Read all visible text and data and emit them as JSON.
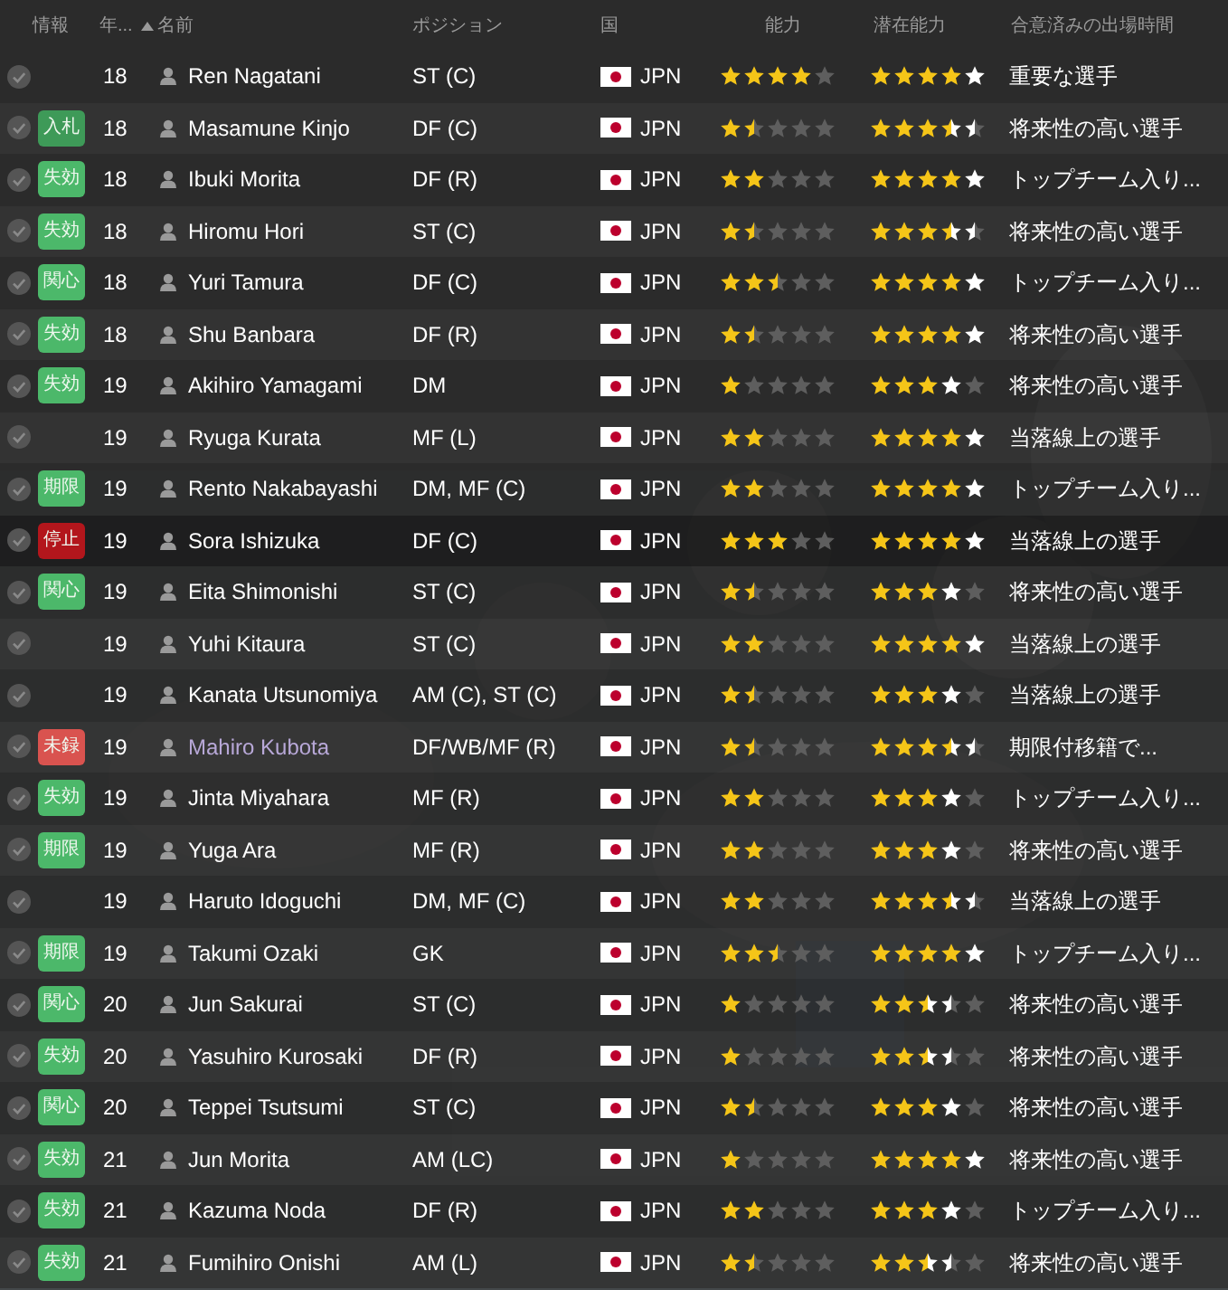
{
  "header": {
    "columns": [
      "情報",
      "年...",
      "名前",
      "ポジション",
      "国",
      "能力",
      "潜在能力",
      "合意済みの出場時間"
    ]
  },
  "rows": [
    {
      "selected": false,
      "age": "18",
      "name": "Ren Nagatani",
      "color": "#ffffff",
      "position": "ST (C)",
      "nation": "JPN",
      "ability": {
        "stars": 4
      },
      "potential": {
        "stars": 4,
        "uncertain": true
      },
      "playing_time": "重要な選手"
    },
    {
      "selected": false,
      "badge": {
        "text": "入札",
        "color": "#3e9a58"
      },
      "age": "18",
      "name": "Masamune Kinjo",
      "color": "#ffffff",
      "position": "DF (C)",
      "nation": "JPN",
      "ability": {
        "stars": 1.5
      },
      "potential": {
        "stars": 3.5,
        "uncertain": true
      },
      "playing_time": "将来性の高い選手"
    },
    {
      "selected": false,
      "badge": {
        "text": "失効",
        "color": "#4cb86a"
      },
      "age": "18",
      "name": "Ibuki Morita",
      "color": "#ffffff",
      "position": "DF (R)",
      "nation": "JPN",
      "ability": {
        "stars": 2
      },
      "potential": {
        "stars": 4,
        "uncertain": true
      },
      "playing_time": "トップチーム入り..."
    },
    {
      "selected": false,
      "badge": {
        "text": "失効",
        "color": "#4cb86a"
      },
      "age": "18",
      "name": "Hiromu Hori",
      "color": "#ffffff",
      "position": "ST (C)",
      "nation": "JPN",
      "ability": {
        "stars": 1.5
      },
      "potential": {
        "stars": 3.5,
        "uncertain": true
      },
      "playing_time": "将来性の高い選手"
    },
    {
      "selected": false,
      "badge": {
        "text": "関心",
        "color": "#4cb86a"
      },
      "age": "18",
      "name": "Yuri Tamura",
      "color": "#ffffff",
      "position": "DF (C)",
      "nation": "JPN",
      "ability": {
        "stars": 2.5
      },
      "potential": {
        "stars": 4,
        "uncertain": true
      },
      "playing_time": "トップチーム入り..."
    },
    {
      "selected": false,
      "badge": {
        "text": "失効",
        "color": "#4cb86a"
      },
      "age": "18",
      "name": "Shu Banbara",
      "color": "#ffffff",
      "position": "DF (R)",
      "nation": "JPN",
      "ability": {
        "stars": 1.5
      },
      "potential": {
        "stars": 4,
        "uncertain": true
      },
      "playing_time": "将来性の高い選手"
    },
    {
      "selected": false,
      "badge": {
        "text": "失効",
        "color": "#4cb86a"
      },
      "age": "19",
      "name": "Akihiro Yamagami",
      "color": "#ffffff",
      "position": "DM",
      "nation": "JPN",
      "ability": {
        "stars": 1
      },
      "potential": {
        "stars": 3,
        "uncertain": true
      },
      "playing_time": "将来性の高い選手"
    },
    {
      "selected": false,
      "age": "19",
      "name": "Ryuga Kurata",
      "color": "#ffffff",
      "position": "MF (L)",
      "nation": "JPN",
      "ability": {
        "stars": 2
      },
      "potential": {
        "stars": 4,
        "uncertain": true
      },
      "playing_time": "当落線上の選手"
    },
    {
      "selected": false,
      "badge": {
        "text": "期限",
        "color": "#4cb86a"
      },
      "age": "19",
      "name": "Rento Nakabayashi",
      "color": "#ffffff",
      "position": "DM, MF (C)",
      "nation": "JPN",
      "ability": {
        "stars": 2
      },
      "potential": {
        "stars": 4,
        "uncertain": true
      },
      "playing_time": "トップチーム入り..."
    },
    {
      "selected": true,
      "badge": {
        "text": "停止",
        "color": "#b3161c"
      },
      "age": "19",
      "name": "Sora Ishizuka",
      "color": "#ffffff",
      "position": "DF (C)",
      "nation": "JPN",
      "ability": {
        "stars": 3
      },
      "potential": {
        "stars": 4,
        "uncertain": true
      },
      "playing_time": "当落線上の選手"
    },
    {
      "selected": false,
      "badge": {
        "text": "関心",
        "color": "#4cb86a"
      },
      "age": "19",
      "name": "Eita Shimonishi",
      "color": "#ffffff",
      "position": "ST (C)",
      "nation": "JPN",
      "ability": {
        "stars": 1.5
      },
      "potential": {
        "stars": 3,
        "uncertain": true
      },
      "playing_time": "将来性の高い選手"
    },
    {
      "selected": false,
      "age": "19",
      "name": "Yuhi Kitaura",
      "color": "#ffffff",
      "position": "ST (C)",
      "nation": "JPN",
      "ability": {
        "stars": 2
      },
      "potential": {
        "stars": 4,
        "uncertain": true
      },
      "playing_time": "当落線上の選手"
    },
    {
      "selected": false,
      "age": "19",
      "name": "Kanata Utsunomiya",
      "color": "#ffffff",
      "position": "AM (C), ST (C)",
      "nation": "JPN",
      "ability": {
        "stars": 1.5
      },
      "potential": {
        "stars": 3,
        "uncertain": true
      },
      "playing_time": "当落線上の選手"
    },
    {
      "selected": false,
      "badge": {
        "text": "未録",
        "color": "#d9534f"
      },
      "age": "19",
      "name": "Mahiro Kubota",
      "color": "#b8a8d8",
      "position": "DF/WB/MF (R)",
      "nation": "JPN",
      "ability": {
        "stars": 1.5
      },
      "potential": {
        "stars": 3.5,
        "uncertain": true
      },
      "playing_time": "期限付移籍で..."
    },
    {
      "selected": false,
      "badge": {
        "text": "失効",
        "color": "#4cb86a"
      },
      "age": "19",
      "name": "Jinta Miyahara",
      "color": "#ffffff",
      "position": "MF (R)",
      "nation": "JPN",
      "ability": {
        "stars": 2
      },
      "potential": {
        "stars": 3,
        "uncertain": true
      },
      "playing_time": "トップチーム入り..."
    },
    {
      "selected": false,
      "badge": {
        "text": "期限",
        "color": "#4cb86a"
      },
      "age": "19",
      "name": "Yuga Ara",
      "color": "#ffffff",
      "position": "MF (R)",
      "nation": "JPN",
      "ability": {
        "stars": 2
      },
      "potential": {
        "stars": 3,
        "uncertain": true
      },
      "playing_time": "将来性の高い選手"
    },
    {
      "selected": false,
      "age": "19",
      "name": "Haruto Idoguchi",
      "color": "#ffffff",
      "position": "DM, MF (C)",
      "nation": "JPN",
      "ability": {
        "stars": 2
      },
      "potential": {
        "stars": 3.5,
        "uncertain": true
      },
      "playing_time": "当落線上の選手"
    },
    {
      "selected": false,
      "badge": {
        "text": "期限",
        "color": "#4cb86a"
      },
      "age": "19",
      "name": "Takumi Ozaki",
      "color": "#ffffff",
      "position": "GK",
      "nation": "JPN",
      "ability": {
        "stars": 2.5
      },
      "potential": {
        "stars": 4,
        "uncertain": true
      },
      "playing_time": "トップチーム入り..."
    },
    {
      "selected": false,
      "badge": {
        "text": "関心",
        "color": "#4cb86a"
      },
      "age": "20",
      "name": "Jun Sakurai",
      "color": "#ffffff",
      "position": "ST (C)",
      "nation": "JPN",
      "ability": {
        "stars": 1
      },
      "potential": {
        "stars": 2.5,
        "uncertain": true
      },
      "playing_time": "将来性の高い選手"
    },
    {
      "selected": false,
      "badge": {
        "text": "失効",
        "color": "#4cb86a"
      },
      "age": "20",
      "name": "Yasuhiro Kurosaki",
      "color": "#ffffff",
      "position": "DF (R)",
      "nation": "JPN",
      "ability": {
        "stars": 1
      },
      "potential": {
        "stars": 2.5,
        "uncertain": true
      },
      "playing_time": "将来性の高い選手"
    },
    {
      "selected": false,
      "badge": {
        "text": "関心",
        "color": "#4cb86a"
      },
      "age": "20",
      "name": "Teppei Tsutsumi",
      "color": "#ffffff",
      "position": "ST (C)",
      "nation": "JPN",
      "ability": {
        "stars": 1.5
      },
      "potential": {
        "stars": 3,
        "uncertain": true
      },
      "playing_time": "将来性の高い選手"
    },
    {
      "selected": false,
      "badge": {
        "text": "失効",
        "color": "#4cb86a"
      },
      "age": "21",
      "name": "Jun Morita",
      "color": "#ffffff",
      "position": "AM (LC)",
      "nation": "JPN",
      "ability": {
        "stars": 1
      },
      "potential": {
        "stars": 4,
        "uncertain": true
      },
      "playing_time": "将来性の高い選手"
    },
    {
      "selected": false,
      "badge": {
        "text": "失効",
        "color": "#4cb86a"
      },
      "age": "21",
      "name": "Kazuma Noda",
      "color": "#ffffff",
      "position": "DF (R)",
      "nation": "JPN",
      "ability": {
        "stars": 2
      },
      "potential": {
        "stars": 3,
        "uncertain": true
      },
      "playing_time": "トップチーム入り..."
    },
    {
      "selected": false,
      "badge": {
        "text": "失効",
        "color": "#4cb86a"
      },
      "age": "21",
      "name": "Fumihiro Onishi",
      "color": "#ffffff",
      "position": "AM (L)",
      "nation": "JPN",
      "ability": {
        "stars": 1.5
      },
      "potential": {
        "stars": 2.5,
        "uncertain": true
      },
      "playing_time": "将来性の高い選手"
    }
  ]
}
